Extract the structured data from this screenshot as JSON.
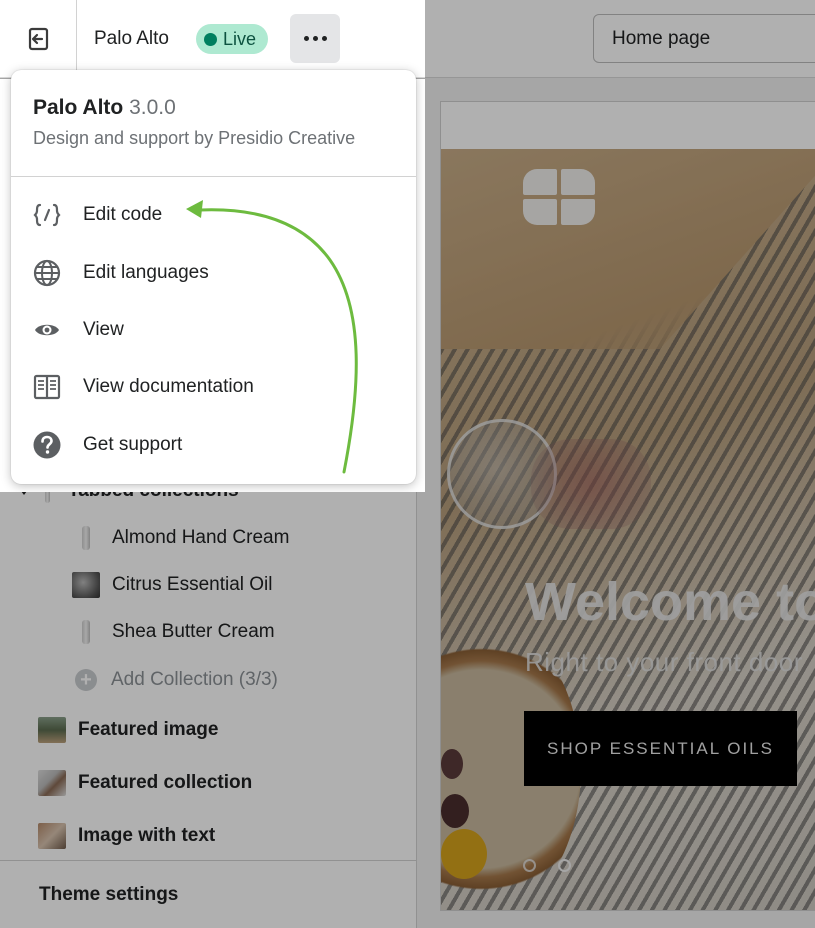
{
  "topbar": {
    "theme_name": "Palo Alto",
    "status_badge": "Live",
    "page_selector": "Home page"
  },
  "menu": {
    "theme_name": "Palo Alto",
    "version": "3.0.0",
    "subtitle": "Design and support by Presidio Creative",
    "items": [
      {
        "label": "Edit code",
        "icon": "code-icon"
      },
      {
        "label": "Edit languages",
        "icon": "globe-icon"
      },
      {
        "label": "View",
        "icon": "eye-icon"
      },
      {
        "label": "View documentation",
        "icon": "book-icon"
      },
      {
        "label": "Get support",
        "icon": "question-icon"
      }
    ]
  },
  "sidebar": {
    "tabbed_collections": "Tabbed collections",
    "collections": [
      {
        "label": "Almond Hand Cream"
      },
      {
        "label": "Citrus Essential Oil"
      },
      {
        "label": "Shea Butter Cream"
      }
    ],
    "add_collection": "Add Collection (3/3)",
    "sections": [
      {
        "label": "Featured image"
      },
      {
        "label": "Featured collection"
      },
      {
        "label": "Image with text"
      }
    ],
    "theme_settings": "Theme settings"
  },
  "preview": {
    "hero_title": "Welcome to",
    "hero_subtitle": "Right to your front door",
    "hero_button": "SHOP ESSENTIAL OILS"
  },
  "colors": {
    "live_badge_bg": "#aee9d1",
    "live_dot": "#007f5f",
    "annotation_arrow": "#6dbb3f",
    "hero_button_bg": "#000000"
  }
}
